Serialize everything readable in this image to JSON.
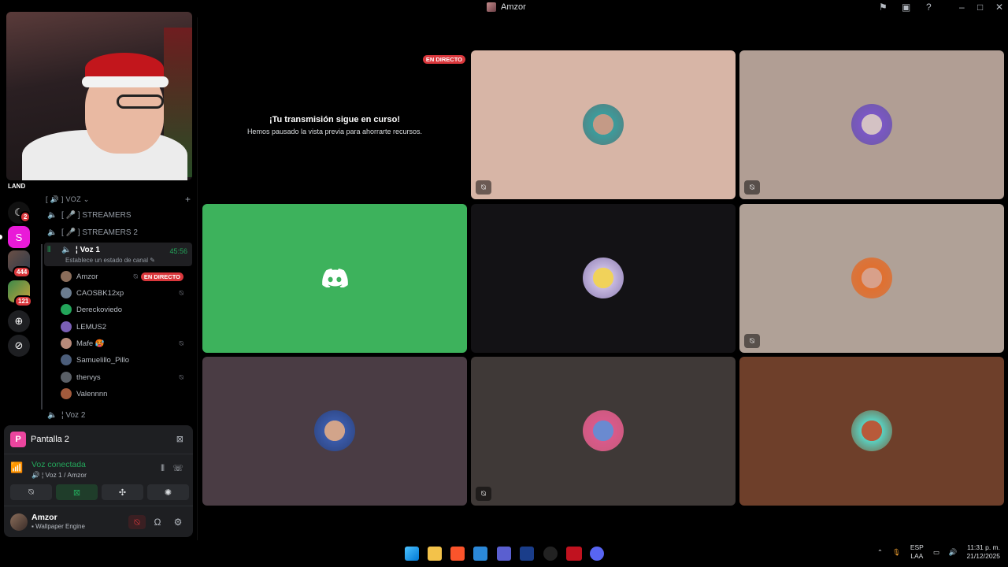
{
  "window": {
    "title": "Amzor",
    "controls": [
      "inbox-icon",
      "screen-icon",
      "help-icon",
      "minimize-icon",
      "maximize-icon",
      "close-icon"
    ]
  },
  "rail": {
    "server_label": "LAND",
    "badges": [
      "2",
      "444",
      "121"
    ],
    "letter_icon": "S"
  },
  "channels": {
    "category": "[ 🔊 ] VOZ",
    "add": "+",
    "list": [
      {
        "label": "[ 🎤 ] STREAMERS"
      },
      {
        "label": "[ 🎤 ] STREAMERS 2"
      },
      {
        "label": "¦ Voz 1",
        "time": "45:56",
        "status": "Establece un estado de canal ✎"
      },
      {
        "label": "¦ Voz 2"
      }
    ],
    "users": [
      {
        "name": "Amzor",
        "live": "EN DIRECTO",
        "color": "#8a6d5a"
      },
      {
        "name": "CAOSBK12xp",
        "color": "#6b7c8f"
      },
      {
        "name": "Dereckoviedo",
        "color": "#23a55a"
      },
      {
        "name": "LEMUS2",
        "color": "#7a5fb5"
      },
      {
        "name": "Mafe 🥵",
        "color": "#b88a7a"
      },
      {
        "name": "Samuelillo_Pillo",
        "color": "#4b5d7a"
      },
      {
        "name": "thervys",
        "color": "#5a5f66"
      },
      {
        "name": "Valennnn",
        "color": "#a25a3c"
      }
    ]
  },
  "user_panel": {
    "stream_label": "Pantalla 2",
    "stream_initial": "P",
    "voice_title": "Voz conectada",
    "voice_sub": "🔊 ¦ Voz 1 / Amzor",
    "username": "Amzor",
    "user_status": "Wallpaper Engine"
  },
  "stage": {
    "live_badge": "EN DIRECTO",
    "paused_title": "¡Tu transmisión sigue en curso!",
    "paused_text": "Hemos pausado la vista previa para ahorrarte recursos.",
    "tiles": [
      {
        "bg": "#d7b5a6",
        "avatar": "#5a7a7a",
        "muted": true
      },
      {
        "bg": "#b19e94",
        "avatar": "#6d5aa0",
        "muted": true
      },
      {
        "bg": "#3db25c",
        "discord": true,
        "muted": false
      },
      {
        "bg": "#131215",
        "avatar": "#c7b9e0",
        "muted": false
      },
      {
        "bg": "#b0a197",
        "avatar": "#d07a4a",
        "muted": true
      },
      {
        "bg": "#4a3c44",
        "avatar": "#3a5aa8",
        "muted": false
      },
      {
        "bg": "#3f3937",
        "avatar": "#c85a7a",
        "muted": true
      },
      {
        "bg": "#6e3f2a",
        "avatar": "#7a5a3a",
        "muted": false
      }
    ]
  },
  "taskbar": {
    "lang_top": "ESP",
    "lang_bottom": "LAA",
    "time": "11:31 p. m.",
    "date": "21/12/2025"
  },
  "colors": {
    "green": "#23a55a",
    "red": "#da373c",
    "discord_green": "#3db25c"
  }
}
